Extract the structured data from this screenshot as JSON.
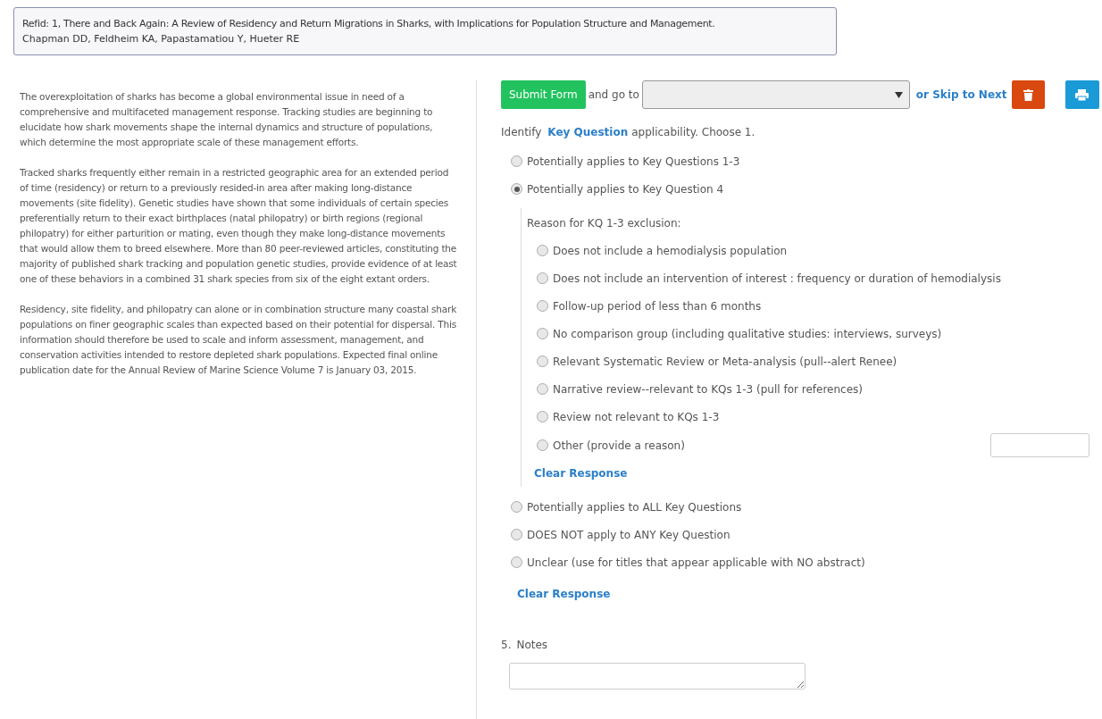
{
  "reference": {
    "title": "Refid: 1, There and Back Again: A Review of Residency and Return Migrations in Sharks, with Implications for Population Structure and Management.",
    "authors": "Chapman DD, Feldheim KA, Papastamatiou Y, Hueter RE"
  },
  "abstract": [
    "The overexploitation of sharks has become a global environmental issue in need of a comprehensive and multifaceted management response. Tracking studies are beginning to elucidate how shark movements shape the internal dynamics and structure of populations, which determine the most appropriate scale of these management efforts.",
    "Tracked sharks frequently either remain in a restricted geographic area for an extended period of time (residency) or return to a previously resided-in area after making long-distance movements (site fidelity). Genetic studies have shown that some individuals of certain species preferentially return to their exact birthplaces (natal philopatry) or birth regions (regional philopatry) for either parturition or mating, even though they make long-distance movements that would allow them to breed elsewhere. More than 80 peer-reviewed articles, constituting the majority of published shark tracking and population genetic studies, provide evidence of at least one of these behaviors in a combined 31 shark species from six of the eight extant orders.",
    "Residency, site fidelity, and philopatry can alone or in combination structure many coastal shark populations on finer geographic scales than expected based on their potential for dispersal. This information should therefore be used to scale and inform assessment, management, and conservation activities intended to restore depleted shark populations. Expected final online publication date for the Annual Review of Marine Science Volume 7 is January 03, 2015."
  ],
  "toolbar": {
    "submit": "Submit Form",
    "go_to": "and go to",
    "skip": "or Skip to Next"
  },
  "question": {
    "prompt_before": "Identify",
    "prompt_link": "Key Question",
    "prompt_after": "applicability. Choose 1.",
    "options": [
      {
        "label": "Potentially applies to Key Questions 1-3",
        "selected": false
      },
      {
        "label": "Potentially applies to Key Question 4",
        "selected": true,
        "sub_heading": "Reason for KQ 1-3 exclusion:",
        "sub_clear": "Clear Response",
        "children": [
          {
            "kind": "plain",
            "label": "Does not include a hemodialysis population",
            "selected": false
          },
          {
            "kind": "plain",
            "label": "Does not include an intervention of interest : frequency or duration of hemodialysis",
            "selected": false
          },
          {
            "kind": "plain",
            "label": "Follow-up period of less than 6 months",
            "selected": false
          },
          {
            "kind": "plain",
            "label": "No comparison group (including qualitative studies: interviews, surveys)",
            "selected": false
          },
          {
            "kind": "plain",
            "label": "Relevant Systematic Review or Meta-analysis (pull--alert Renee)",
            "selected": false
          },
          {
            "kind": "plain",
            "label": "Narrative review--relevant to KQs 1-3 (pull for references)",
            "selected": false
          },
          {
            "kind": "plain",
            "label": "Review not relevant to KQs 1-3",
            "selected": false
          },
          {
            "kind": "other",
            "label": "Other (provide a reason)",
            "selected": false
          }
        ]
      },
      {
        "label": "Potentially applies to ALL Key Questions",
        "selected": false
      },
      {
        "label": "DOES NOT apply to ANY Key Question",
        "selected": false
      },
      {
        "label": "Unclear (use for titles that appear applicable with NO abstract)",
        "selected": false
      }
    ],
    "clear": "Clear Response"
  },
  "notes": {
    "number": "5.",
    "label": "Notes"
  }
}
